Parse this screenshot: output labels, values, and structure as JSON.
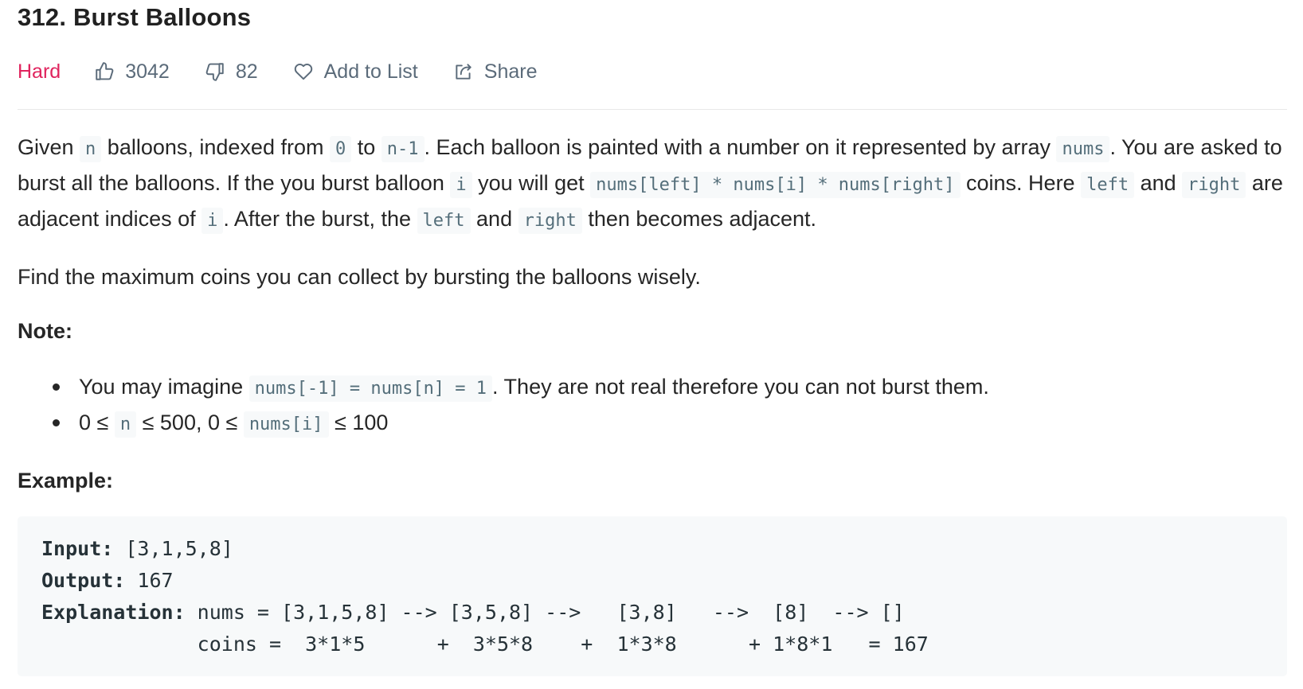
{
  "problem": {
    "title": "312. Burst Balloons",
    "difficulty": "Hard",
    "likes": "3042",
    "dislikes": "82",
    "add_to_list": "Add to List",
    "share": "Share"
  },
  "icons": {
    "like": "thumbs-up-icon",
    "dislike": "thumbs-down-icon",
    "add_to_list": "heart-icon",
    "share": "share-icon"
  },
  "colors": {
    "difficulty_hard": "#e0245e",
    "meta_text": "#5b6b7a",
    "code_bg": "#f7f9fa",
    "code_text": "#546e7a"
  },
  "description": {
    "p1": {
      "t1": "Given ",
      "c_n": "n",
      "t2": " balloons, indexed from ",
      "c_0": "0",
      "t3": " to ",
      "c_n1": "n-1",
      "t4": ". Each balloon is painted with a number on it represented by array ",
      "c_nums": "nums",
      "t5": ". You are asked to burst all the balloons. If the you burst balloon ",
      "c_i": "i",
      "t6": " you will get ",
      "c_formula": "nums[left] * nums[i] * nums[right]",
      "t7": " coins. Here ",
      "c_left": "left",
      "t8": " and ",
      "c_right": "right",
      "t9": " are adjacent indices of ",
      "c_i2": "i",
      "t10": ". After the burst, the ",
      "c_left2": "left",
      "t11": " and ",
      "c_right2": "right",
      "t12": " then becomes adjacent."
    },
    "p2": "Find the maximum coins you can collect by bursting the balloons wisely.",
    "note_heading": "Note:",
    "note1": {
      "t1": "You may imagine ",
      "code": "nums[-1] = nums[n] = 1",
      "t2": ". They are not real therefore you can not burst them."
    },
    "note2": {
      "t1": "0 ≤ ",
      "c_n": "n",
      "t2": " ≤ 500, 0 ≤ ",
      "c_nums": "nums[i]",
      "t3": " ≤ 100"
    },
    "example_heading": "Example:"
  },
  "example": {
    "input_label": "Input:",
    "input_value": " [3,1,5,8]",
    "output_label": "Output:",
    "output_value": " 167",
    "explanation_label": "Explanation:",
    "explanation_line1": " nums = [3,1,5,8] --> [3,5,8] -->   [3,8]   -->  [8]  --> []",
    "explanation_line2": "             coins =  3*1*5      +  3*5*8    +  1*3*8      + 1*8*1   = 167"
  }
}
